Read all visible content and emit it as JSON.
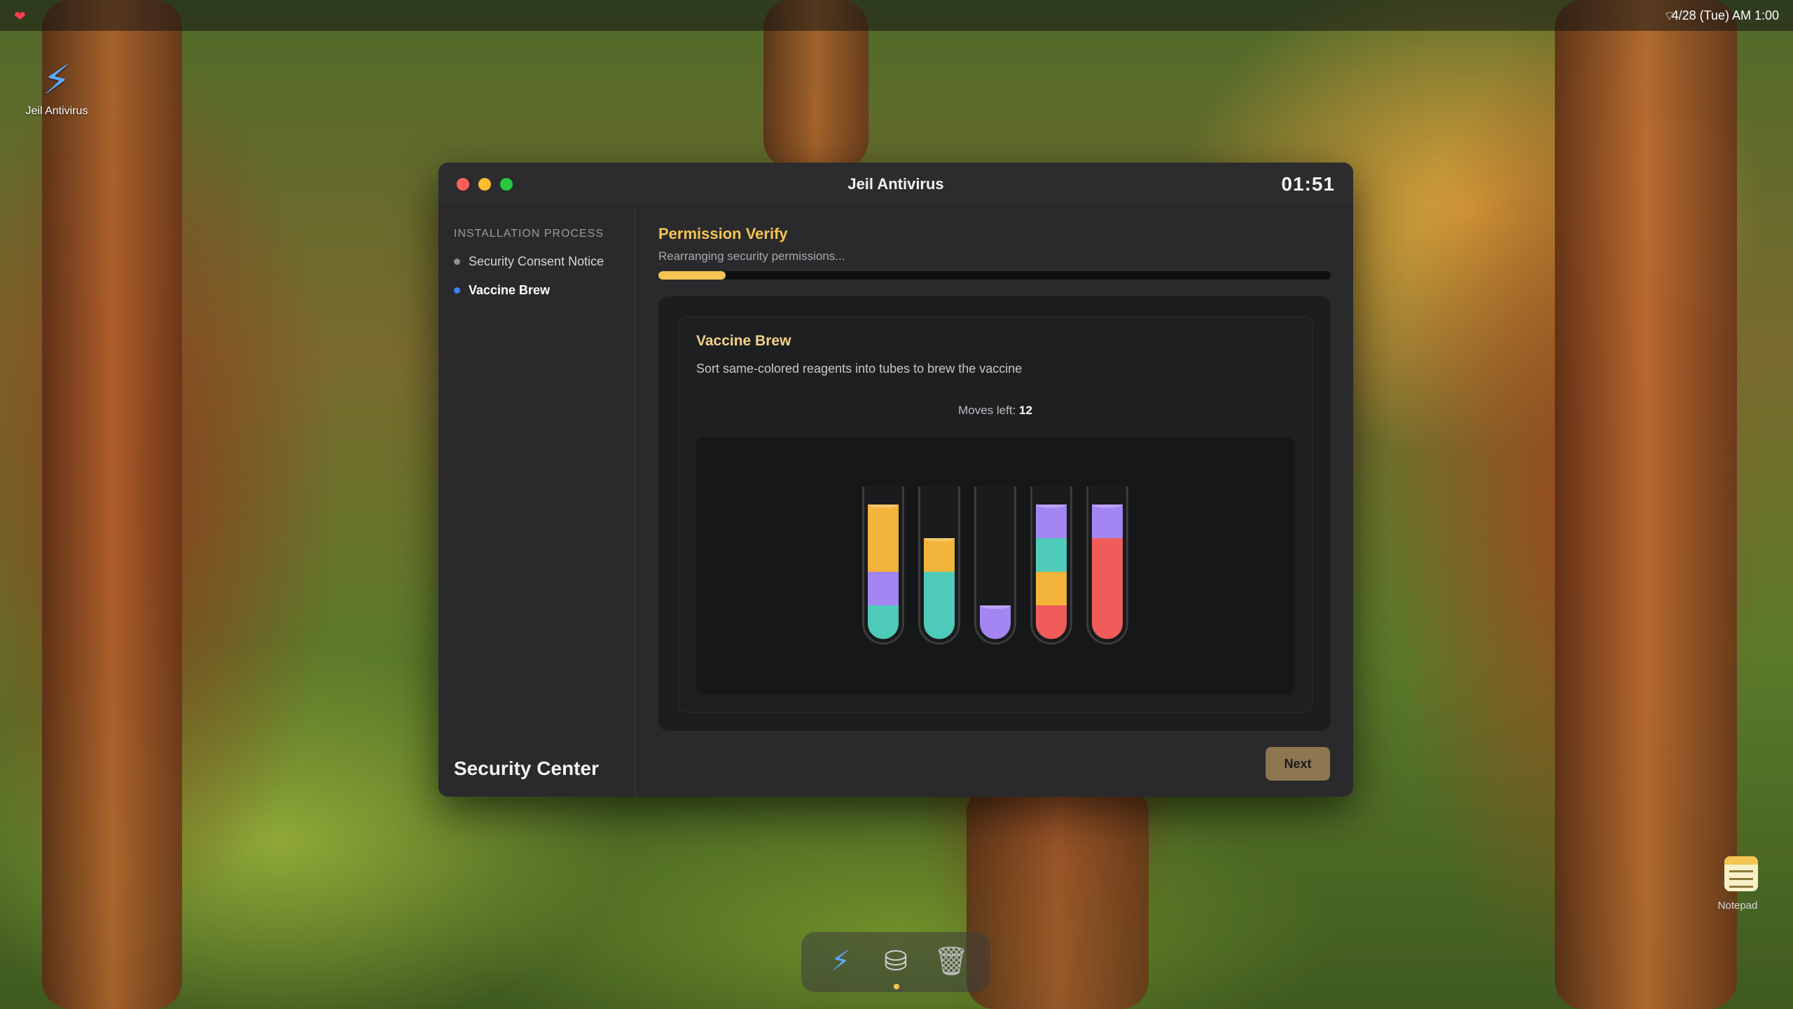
{
  "menubar": {
    "clock": "4/28 (Tue) AM 1:00",
    "heart_icon": "heart-icon",
    "wifi_icon": "wifi-off-icon"
  },
  "desktop": {
    "antivirus_label": "Jeil Antivirus",
    "notepad_label": "Notepad"
  },
  "window": {
    "title": "Jeil Antivirus",
    "timer": "01:51"
  },
  "sidebar": {
    "heading": "INSTALLATION PROCESS",
    "items": [
      {
        "label": "Security Consent Notice",
        "active": false
      },
      {
        "label": "Vaccine Brew",
        "active": true
      }
    ],
    "footer": "Security Center"
  },
  "main": {
    "step_title": "Permission Verify",
    "step_subtitle": "Rearranging security permissions...",
    "progress_percent": 10,
    "game": {
      "title": "Vaccine Brew",
      "description": "Sort same-colored reagents into tubes to brew the vaccine",
      "moves_label": "Moves left: ",
      "moves_value": "12",
      "colors": {
        "yellow": "#f2b43a",
        "purple": "#a486f2",
        "teal": "#4ecbb9",
        "red": "#ef5c5a"
      },
      "tubes": [
        [
          "teal",
          "purple",
          "yellow",
          "yellow"
        ],
        [
          "teal",
          "teal",
          "yellow"
        ],
        [
          "purple"
        ],
        [
          "red",
          "yellow",
          "teal",
          "purple"
        ],
        [
          "red",
          "red",
          "red",
          "purple"
        ]
      ]
    },
    "next_label": "Next"
  },
  "dock": {
    "items": [
      "antivirus-icon",
      "disk-icon",
      "trash-icon"
    ]
  }
}
